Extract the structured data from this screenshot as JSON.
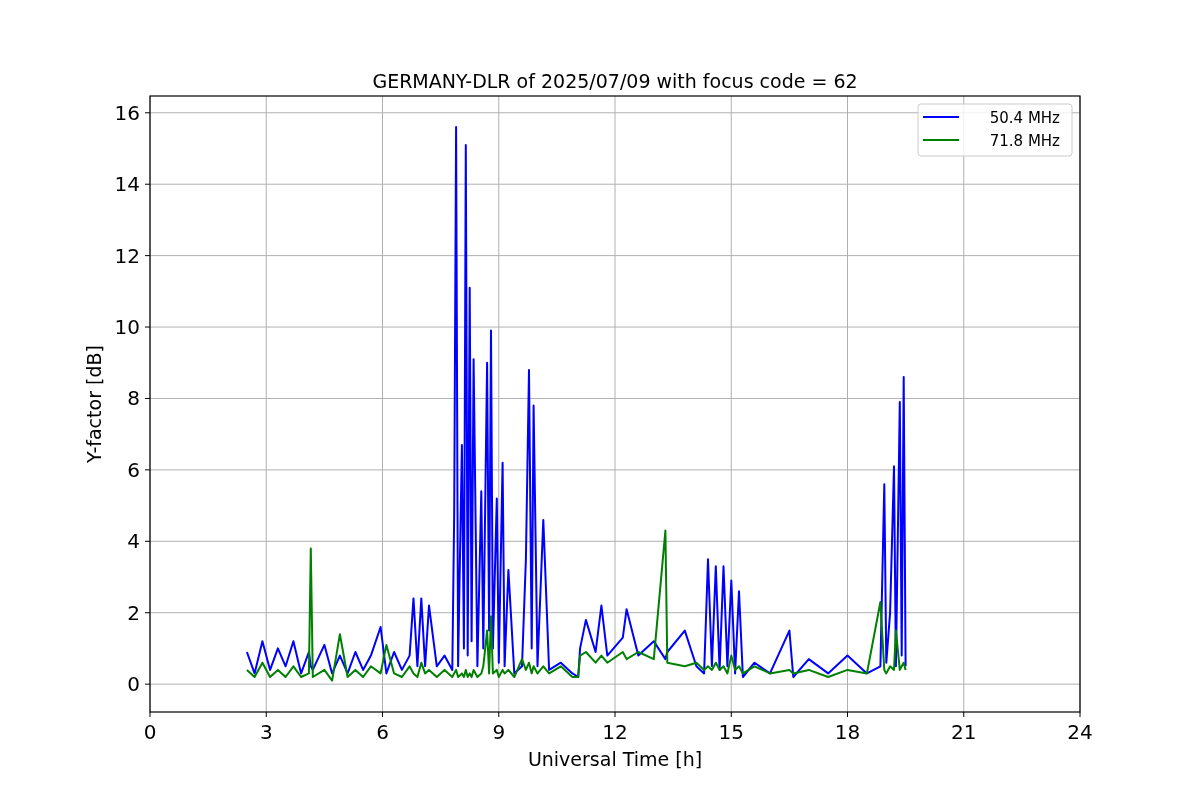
{
  "chart_data": {
    "type": "line",
    "title": "GERMANY-DLR of 2025/07/09 with focus code = 62",
    "xlabel": "Universal Time [h]",
    "ylabel": "Y-factor [dB]",
    "x": [
      2.5,
      2.7,
      2.9,
      3.1,
      3.3,
      3.5,
      3.7,
      3.9,
      4.1,
      4.15,
      4.2,
      4.5,
      4.7,
      4.9,
      5.1,
      5.3,
      5.5,
      5.7,
      5.95,
      6.1,
      6.3,
      6.5,
      6.7,
      6.8,
      6.9,
      7.0,
      7.1,
      7.2,
      7.4,
      7.6,
      7.8,
      7.85,
      7.9,
      7.95,
      8.05,
      8.1,
      8.15,
      8.2,
      8.25,
      8.3,
      8.35,
      8.45,
      8.55,
      8.6,
      8.7,
      8.75,
      8.8,
      8.85,
      8.95,
      9.0,
      9.1,
      9.15,
      9.25,
      9.4,
      9.6,
      9.7,
      9.78,
      9.85,
      9.9,
      10.0,
      10.15,
      10.3,
      10.6,
      10.9,
      11.05,
      11.1,
      11.25,
      11.5,
      11.65,
      11.8,
      12.2,
      12.3,
      12.6,
      13.0,
      13.3,
      13.35,
      13.8,
      14.1,
      14.3,
      14.4,
      14.5,
      14.6,
      14.7,
      14.8,
      14.9,
      15.0,
      15.1,
      15.2,
      15.3,
      15.6,
      16.0,
      16.5,
      16.6,
      17.0,
      17.5,
      18.0,
      18.5,
      18.85,
      18.95,
      19.0,
      19.1,
      19.2,
      19.25,
      19.35,
      19.4,
      19.45,
      19.5
    ],
    "series": [
      {
        "name": "50.4 MHz",
        "color": "#0000ff",
        "values": [
          0.9,
          0.3,
          1.2,
          0.4,
          1.0,
          0.5,
          1.2,
          0.3,
          0.9,
          0.5,
          0.4,
          1.1,
          0.3,
          0.8,
          0.3,
          0.9,
          0.4,
          0.8,
          1.6,
          0.3,
          0.9,
          0.4,
          0.8,
          2.4,
          0.5,
          2.4,
          0.5,
          2.2,
          0.5,
          0.8,
          0.4,
          4.8,
          15.6,
          0.5,
          6.7,
          1.0,
          15.1,
          0.8,
          11.1,
          1.2,
          9.1,
          0.5,
          5.4,
          1.0,
          9.0,
          1.5,
          9.9,
          1.0,
          5.2,
          0.6,
          6.2,
          0.5,
          3.2,
          0.3,
          0.5,
          3.5,
          8.8,
          1.0,
          7.8,
          0.5,
          4.6,
          0.4,
          0.6,
          0.3,
          0.2,
          1.0,
          1.8,
          0.9,
          2.2,
          0.8,
          1.3,
          2.1,
          0.8,
          1.2,
          0.7,
          0.9,
          1.5,
          0.5,
          0.3,
          3.5,
          0.5,
          3.3,
          0.4,
          3.3,
          0.5,
          2.9,
          0.3,
          2.6,
          0.2,
          0.6,
          0.3,
          1.5,
          0.2,
          0.7,
          0.3,
          0.8,
          0.3,
          0.5,
          5.6,
          0.6,
          2.0,
          6.1,
          0.5,
          7.9,
          0.8,
          8.6,
          0.5
        ]
      },
      {
        "name": "71.8 MHz",
        "color": "#008000",
        "values": [
          0.4,
          0.2,
          0.6,
          0.2,
          0.4,
          0.2,
          0.5,
          0.2,
          0.3,
          3.8,
          0.2,
          0.4,
          0.1,
          1.4,
          0.2,
          0.4,
          0.2,
          0.5,
          0.3,
          1.1,
          0.3,
          0.2,
          0.5,
          0.3,
          0.2,
          0.6,
          0.3,
          0.4,
          0.2,
          0.4,
          0.2,
          0.3,
          0.4,
          0.2,
          0.3,
          0.2,
          0.4,
          0.2,
          0.3,
          0.2,
          0.4,
          0.2,
          0.3,
          0.5,
          1.5,
          0.3,
          1.9,
          0.3,
          0.4,
          0.2,
          0.4,
          0.3,
          0.4,
          0.2,
          0.7,
          0.4,
          0.6,
          0.3,
          0.5,
          0.3,
          0.5,
          0.3,
          0.5,
          0.2,
          0.2,
          0.8,
          0.9,
          0.6,
          0.8,
          0.6,
          0.9,
          0.7,
          0.9,
          0.7,
          4.3,
          0.6,
          0.5,
          0.6,
          0.4,
          0.5,
          0.4,
          0.6,
          0.4,
          0.5,
          0.3,
          0.8,
          0.4,
          0.5,
          0.3,
          0.5,
          0.3,
          0.4,
          0.3,
          0.4,
          0.2,
          0.4,
          0.3,
          2.3,
          0.4,
          0.3,
          0.5,
          0.4,
          1.5,
          0.4,
          0.5,
          0.6,
          0.4
        ]
      }
    ],
    "xlim": [
      0,
      24
    ],
    "ylim": [
      -0.78,
      16.47
    ],
    "xticks": [
      0,
      3,
      6,
      9,
      12,
      15,
      18,
      21,
      24
    ],
    "yticks": [
      0,
      2,
      4,
      6,
      8,
      10,
      12,
      14,
      16
    ],
    "grid": true,
    "legend": true
  }
}
